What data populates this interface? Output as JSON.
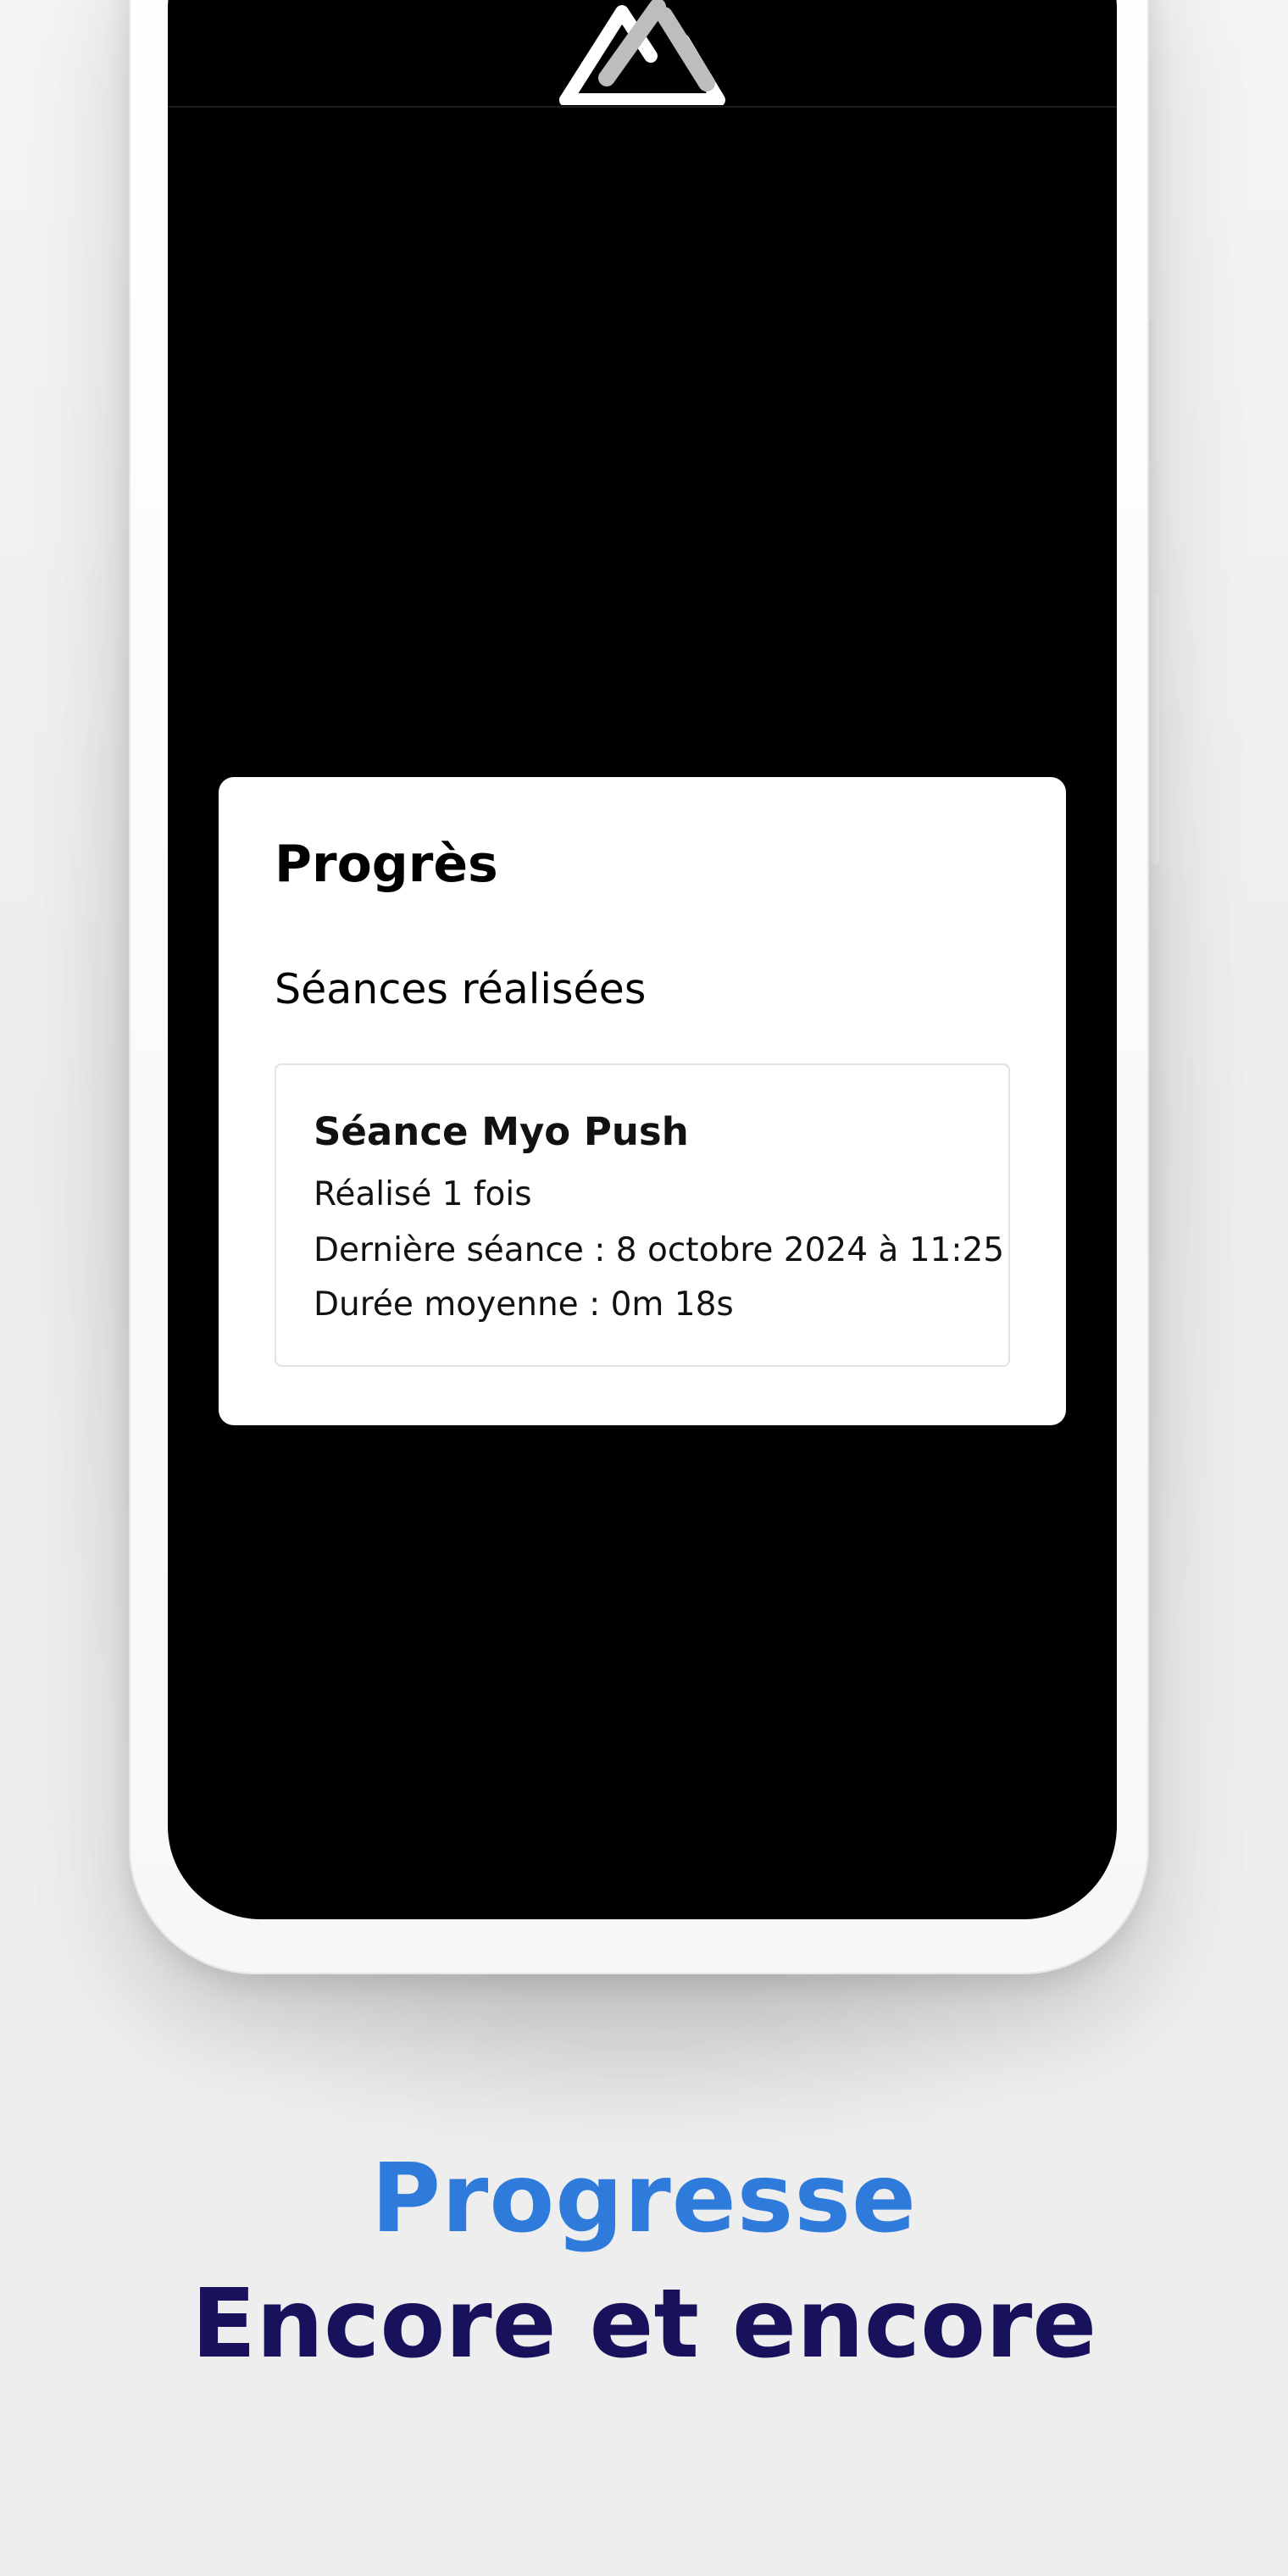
{
  "app": {
    "logo_icon": "triangle-logo-icon"
  },
  "progress_card": {
    "title": "Progrès",
    "section_title": "Séances réalisées",
    "sessions": [
      {
        "name": "Séance Myo Push",
        "completed": "Réalisé 1 fois",
        "last_session": "Dernière séance : 8 octobre 2024 à 11:25",
        "average_duration": "Durée moyenne : 0m 18s"
      }
    ]
  },
  "promo": {
    "headline": "Progresse",
    "subheadline": "Encore et encore",
    "headline_color": "#2f7bdc",
    "subheadline_color": "#18125c"
  }
}
